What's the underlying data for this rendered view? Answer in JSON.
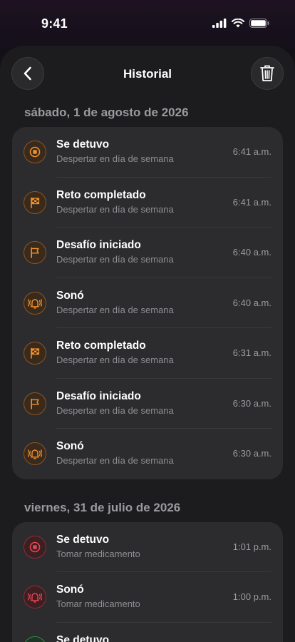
{
  "status_bar": {
    "time": "9:41"
  },
  "nav": {
    "title": "Historial"
  },
  "sections": [
    {
      "date": "sábado, 1 de agosto de 2026",
      "items": [
        {
          "title": "Se detuvo",
          "subtitle": "Despertar en día de semana",
          "time": "6:41 a.m.",
          "icon": "stop-icon",
          "color": "#f0922e"
        },
        {
          "title": "Reto completado",
          "subtitle": "Despertar en día de semana",
          "time": "6:41 a.m.",
          "icon": "checkered-flag-icon",
          "color": "#f0922e"
        },
        {
          "title": "Desafío iniciado",
          "subtitle": "Despertar en día de semana",
          "time": "6:40 a.m.",
          "icon": "flag-icon",
          "color": "#f0922e"
        },
        {
          "title": "Sonó",
          "subtitle": "Despertar en día de semana",
          "time": "6:40 a.m.",
          "icon": "ringing-bell-icon",
          "color": "#f0922e"
        },
        {
          "title": "Reto completado",
          "subtitle": "Despertar en día de semana",
          "time": "6:31 a.m.",
          "icon": "checkered-flag-icon",
          "color": "#f0922e"
        },
        {
          "title": "Desafío iniciado",
          "subtitle": "Despertar en día de semana",
          "time": "6:30 a.m.",
          "icon": "flag-icon",
          "color": "#f0922e"
        },
        {
          "title": "Sonó",
          "subtitle": "Despertar en día de semana",
          "time": "6:30 a.m.",
          "icon": "ringing-bell-icon",
          "color": "#f0922e"
        }
      ]
    },
    {
      "date": "viernes, 31 de julio de 2026",
      "items": [
        {
          "title": "Se detuvo",
          "subtitle": "Tomar medicamento",
          "time": "1:01 p.m.",
          "icon": "stop-icon",
          "color": "#e8454f"
        },
        {
          "title": "Sonó",
          "subtitle": "Tomar medicamento",
          "time": "1:00 p.m.",
          "icon": "ringing-bell-icon",
          "color": "#e8454f"
        },
        {
          "title": "Se detuvo",
          "subtitle": "",
          "time": "",
          "icon": "stop-icon",
          "color": "#3cc35a"
        }
      ]
    }
  ]
}
